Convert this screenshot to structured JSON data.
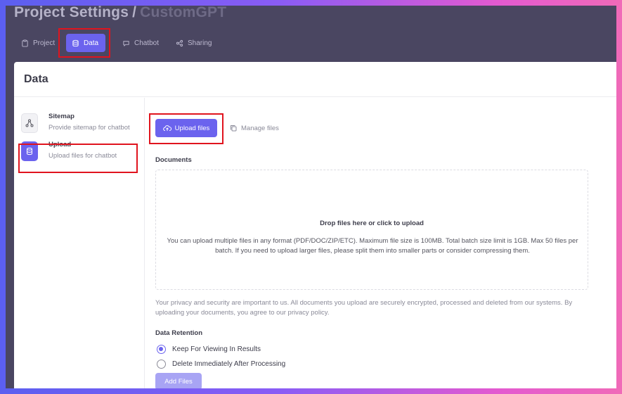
{
  "header": {
    "title": "Project Settings",
    "separator": "/",
    "project_name": "CustomGPT"
  },
  "tabs": [
    {
      "label": "Project",
      "icon": "clipboard-icon",
      "active": false
    },
    {
      "label": "Data",
      "icon": "database-icon",
      "active": true
    },
    {
      "label": "Chatbot",
      "icon": "chat-bubble-icon",
      "active": false
    },
    {
      "label": "Sharing",
      "icon": "share-icon",
      "active": false
    }
  ],
  "panel": {
    "title": "Data"
  },
  "sidebar": {
    "items": [
      {
        "name": "Sitemap",
        "description": "Provide sitemap for chatbot",
        "icon": "sitemap-icon",
        "active": false
      },
      {
        "name": "Upload",
        "description": "Upload files for chatbot",
        "icon": "upload-db-icon",
        "active": true
      }
    ]
  },
  "main": {
    "upload_button": "Upload files",
    "manage_files": "Manage files",
    "documents_label": "Documents",
    "dropzone": {
      "title": "Drop files here or click to upload",
      "text": "You can upload multiple files in any format (PDF/DOC/ZIP/ETC). Maximum file size is 100MB. Total batch size limit is 1GB. Max 50 files per batch. If you need to upload larger files, please split them into smaller parts or consider compressing them."
    },
    "privacy_text": "Your privacy and security are important to us. All documents you upload are securely encrypted, processed and deleted from our systems. By uploading your documents, you agree to our privacy policy.",
    "retention_label": "Data Retention",
    "retention_options": [
      {
        "label": "Keep For Viewing In Results",
        "checked": true
      },
      {
        "label": "Delete Immediately After Processing",
        "checked": false
      }
    ],
    "add_button": "Add Files"
  },
  "colors": {
    "accent": "#6b63ee",
    "highlight": "#e0141e",
    "topbar": "#4a4661"
  }
}
